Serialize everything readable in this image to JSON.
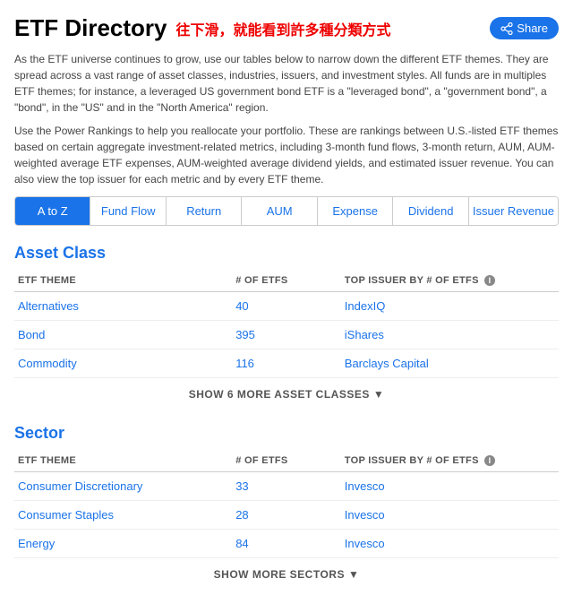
{
  "header": {
    "title": "ETF Directory",
    "chinese_annotation": "往下滑，就能看到許多種分類方式",
    "share_label": "Share"
  },
  "description": {
    "para1": "As the ETF universe continues to grow, use our tables below to narrow down the different ETF themes. They are spread across a vast range of asset classes, industries, issuers, and investment styles. All funds are in multiples ETF themes; for instance, a leveraged US government bond ETF is a \"leveraged bond\", a \"government bond\", a \"bond\", in the \"US\" and in the \"North America\" region.",
    "para2": "Use the Power Rankings to help you reallocate your portfolio. These are rankings between U.S.-listed ETF themes based on certain aggregate investment-related metrics, including 3-month fund flows, 3-month return, AUM, AUM-weighted average ETF expenses, AUM-weighted average dividend yields, and estimated issuer revenue. You can also view the top issuer for each metric and by every ETF theme."
  },
  "tabs": [
    {
      "id": "a-to-z",
      "label": "A to Z",
      "active": true
    },
    {
      "id": "fund-flow",
      "label": "Fund Flow",
      "active": false
    },
    {
      "id": "return",
      "label": "Return",
      "active": false
    },
    {
      "id": "aum",
      "label": "AUM",
      "active": false
    },
    {
      "id": "expense",
      "label": "Expense",
      "active": false
    },
    {
      "id": "dividend",
      "label": "Dividend",
      "active": false
    },
    {
      "id": "issuer-revenue",
      "label": "Issuer Revenue",
      "active": false
    }
  ],
  "sections": [
    {
      "id": "asset-class",
      "title": "Asset Class",
      "col_theme": "ETF THEME",
      "col_num": "# OF ETFs",
      "col_issuer": "TOP ISSUER BY # OF ETFs",
      "rows": [
        {
          "theme": "Alternatives",
          "num": "40",
          "issuer": "IndexIQ"
        },
        {
          "theme": "Bond",
          "num": "395",
          "issuer": "iShares"
        },
        {
          "theme": "Commodity",
          "num": "116",
          "issuer": "Barclays Capital"
        }
      ],
      "show_more_label": "SHOW 6 MORE ASSET CLASSES"
    },
    {
      "id": "sector",
      "title": "Sector",
      "col_theme": "ETF THEME",
      "col_num": "# OF ETFs",
      "col_issuer": "TOP ISSUER BY # OF ETFs",
      "rows": [
        {
          "theme": "Consumer Discretionary",
          "num": "33",
          "issuer": "Invesco"
        },
        {
          "theme": "Consumer Staples",
          "num": "28",
          "issuer": "Invesco"
        },
        {
          "theme": "Energy",
          "num": "84",
          "issuer": "Invesco"
        }
      ],
      "show_more_label": "SHOW MORE SECTORS"
    }
  ]
}
